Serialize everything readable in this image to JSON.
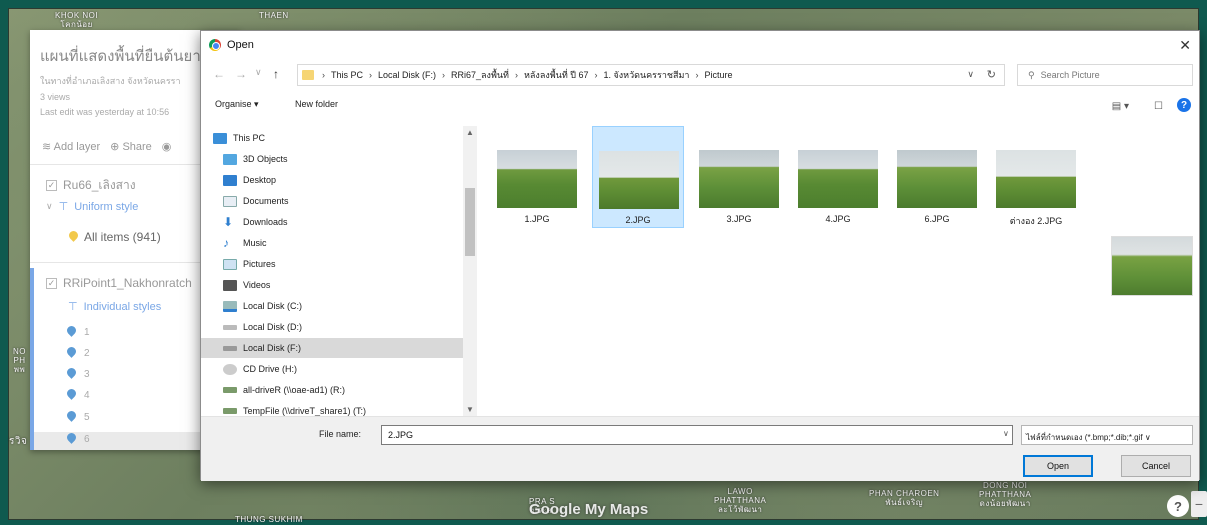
{
  "map": {
    "labels": [
      "KHOK NOI\nโคกน้อย",
      "THAEN",
      "PHAN CHAROEN\nพันธ์เจริญ",
      "DONG NOI\nPHATTHANA\nดงน้อยพัฒนา",
      "LAWO\nPHATTHANA\nละโว้พัฒนา",
      "PRA S\nประส",
      "NO\nPH\nพพ",
      "รวิจ",
      "THUNG SUKHIM"
    ],
    "logo": "Google My Maps",
    "help": "?",
    "zoom_out": "−"
  },
  "panel": {
    "title": "แผนที่แสดงพื้นที่ยืนต้นยาง",
    "description": "ในทางที่อำเภอเลิงสาง จังหวัดนครรา",
    "views": "3 views",
    "last_edit": "Last edit was yesterday at 10:56",
    "add_layer": "Add layer",
    "share": "Share",
    "layer1": {
      "name": "Ru66_เลิงสาง",
      "style": "Uniform style",
      "items": "All items (941)"
    },
    "layer2": {
      "name": "RRiPoint1_Nakhonratch",
      "style": "Individual styles"
    },
    "points": [
      "1",
      "2",
      "3",
      "4",
      "5",
      "6"
    ]
  },
  "dialog": {
    "title": "Open",
    "breadcrumb": [
      "This PC",
      "Local Disk (F:)",
      "RRi67_ลงพื้นที่",
      "หลังลงพื้นที่ ปี 67",
      "1. จังหวัดนครราชสีมา",
      "Picture"
    ],
    "search_placeholder": "Search Picture",
    "organise": "Organise ▾",
    "new_folder": "New folder",
    "nav": [
      "This PC",
      "3D Objects",
      "Desktop",
      "Documents",
      "Downloads",
      "Music",
      "Pictures",
      "Videos",
      "Local Disk (C:)",
      "Local Disk (D:)",
      "Local Disk (F:)",
      "CD Drive (H:)",
      "all-driveR (\\\\oae-ad1) (R:)",
      "TempFile (\\\\driveT_share1) (T:)"
    ],
    "files": [
      "1.JPG",
      "2.JPG",
      "3.JPG",
      "4.JPG",
      "6.JPG",
      "ต่างอง 2.JPG"
    ],
    "file_name_label": "File name:",
    "file_name_value": "2.JPG",
    "filter": "ไฟล์ที่กำหนดเอง (*.bmp;*.dib;*.gif",
    "open_button": "Open",
    "cancel_button": "Cancel"
  }
}
